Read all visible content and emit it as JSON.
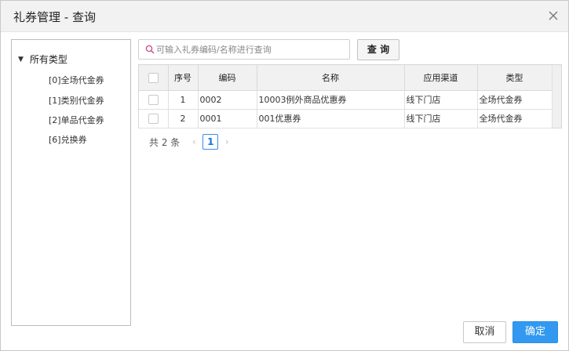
{
  "dialog": {
    "title": "礼券管理 - 查询"
  },
  "tree": {
    "root_label": "所有类型",
    "items": [
      {
        "label": "[0]全场代金券"
      },
      {
        "label": "[1]类别代金券"
      },
      {
        "label": "[2]单品代金券"
      },
      {
        "label": "[6]兑换券"
      }
    ]
  },
  "search": {
    "placeholder": "可输入礼券编码/名称进行查询",
    "value": "",
    "button_label": "查 询"
  },
  "table": {
    "columns": [
      "序号",
      "编码",
      "名称",
      "应用渠道",
      "类型"
    ],
    "rows": [
      {
        "index": "1",
        "code": "0002",
        "name": "10003例外商品优惠券",
        "channel": "线下门店",
        "type": "全场代金券"
      },
      {
        "index": "2",
        "code": "0001",
        "name": "001优惠券",
        "channel": "线下门店",
        "type": "全场代金券"
      }
    ]
  },
  "pager": {
    "total": "共 2 条",
    "current_page": "1"
  },
  "footer": {
    "cancel_label": "取消",
    "ok_label": "确定"
  },
  "colors": {
    "primary": "#3399f0",
    "header_bg": "#f2f2f2",
    "border": "#c8c8c8"
  },
  "icons": {
    "search": "search-icon",
    "close": "close-icon",
    "tree_toggle": "triangle-down-icon"
  }
}
